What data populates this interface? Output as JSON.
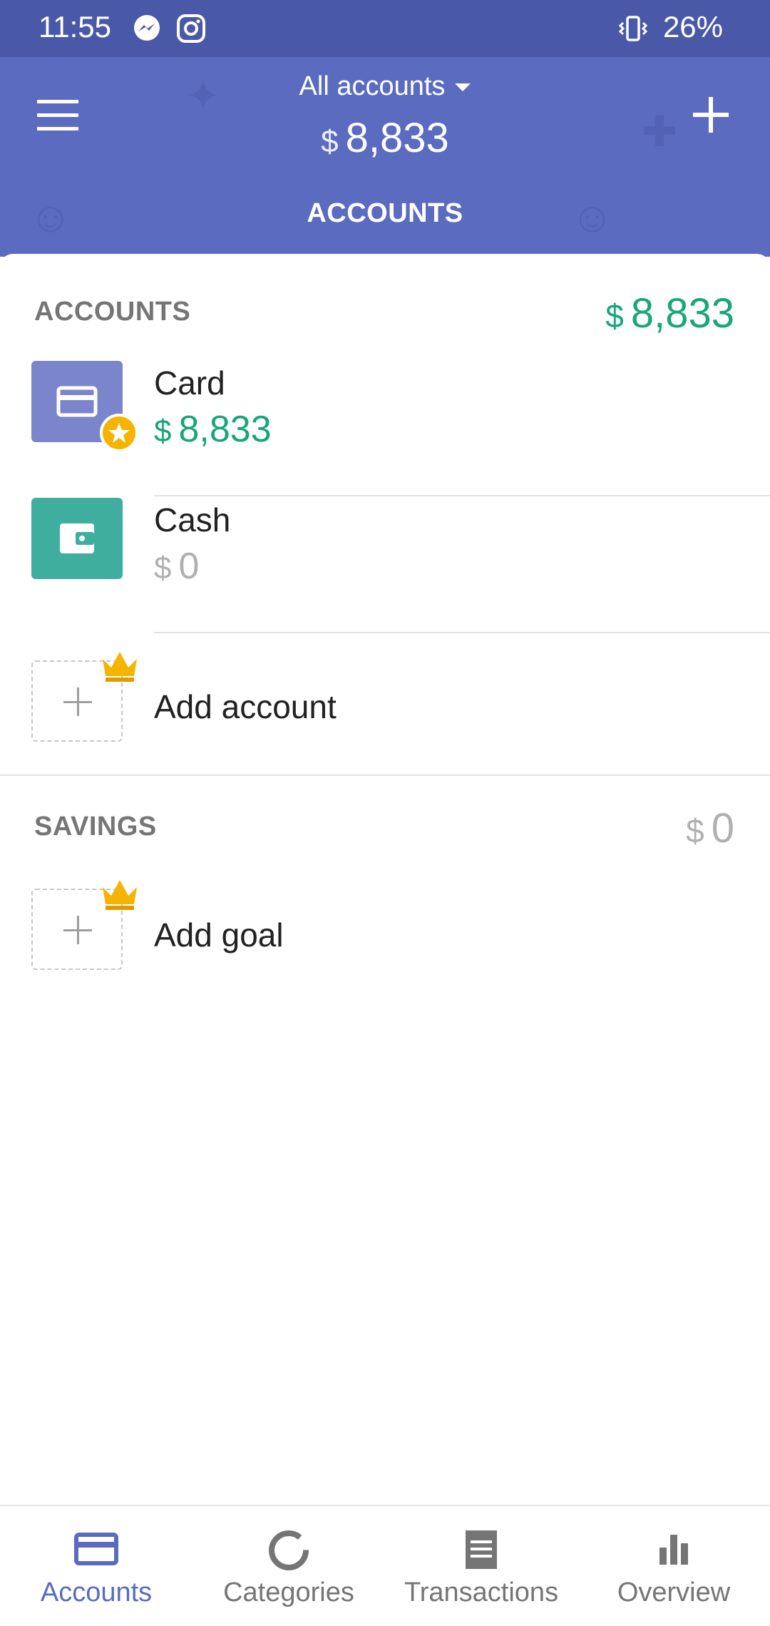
{
  "status_bar": {
    "time": "11:55",
    "battery": "26%",
    "icons": [
      "messenger-icon",
      "instagram-icon",
      "vibrate-icon"
    ]
  },
  "header": {
    "account_selector": "All accounts",
    "currency": "$",
    "total": "8,833",
    "tab": "ACCOUNTS",
    "background_color": "#5b6bc0"
  },
  "accounts_section": {
    "title": "ACCOUNTS",
    "currency": "$",
    "total": "8,833",
    "items": [
      {
        "name": "Card",
        "currency": "$",
        "amount": "8,833",
        "icon": "card-icon",
        "color": "#7a85cc"
      },
      {
        "name": "Cash",
        "currency": "$",
        "amount": "0",
        "icon": "wallet-icon",
        "color": "#3fae9f"
      }
    ],
    "add_label": "Add account"
  },
  "savings_section": {
    "title": "SAVINGS",
    "currency": "$",
    "total": "0",
    "add_label": "Add goal"
  },
  "bottom_nav": {
    "items": [
      {
        "label": "Accounts",
        "icon": "card-icon",
        "active": true
      },
      {
        "label": "Categories",
        "icon": "donut-icon",
        "active": false
      },
      {
        "label": "Transactions",
        "icon": "receipt-icon",
        "active": false
      },
      {
        "label": "Overview",
        "icon": "bar-chart-icon",
        "active": false
      }
    ]
  },
  "colors": {
    "accent": "#5b6bc0",
    "positive": "#17a67b",
    "crown": "#f5b400"
  }
}
